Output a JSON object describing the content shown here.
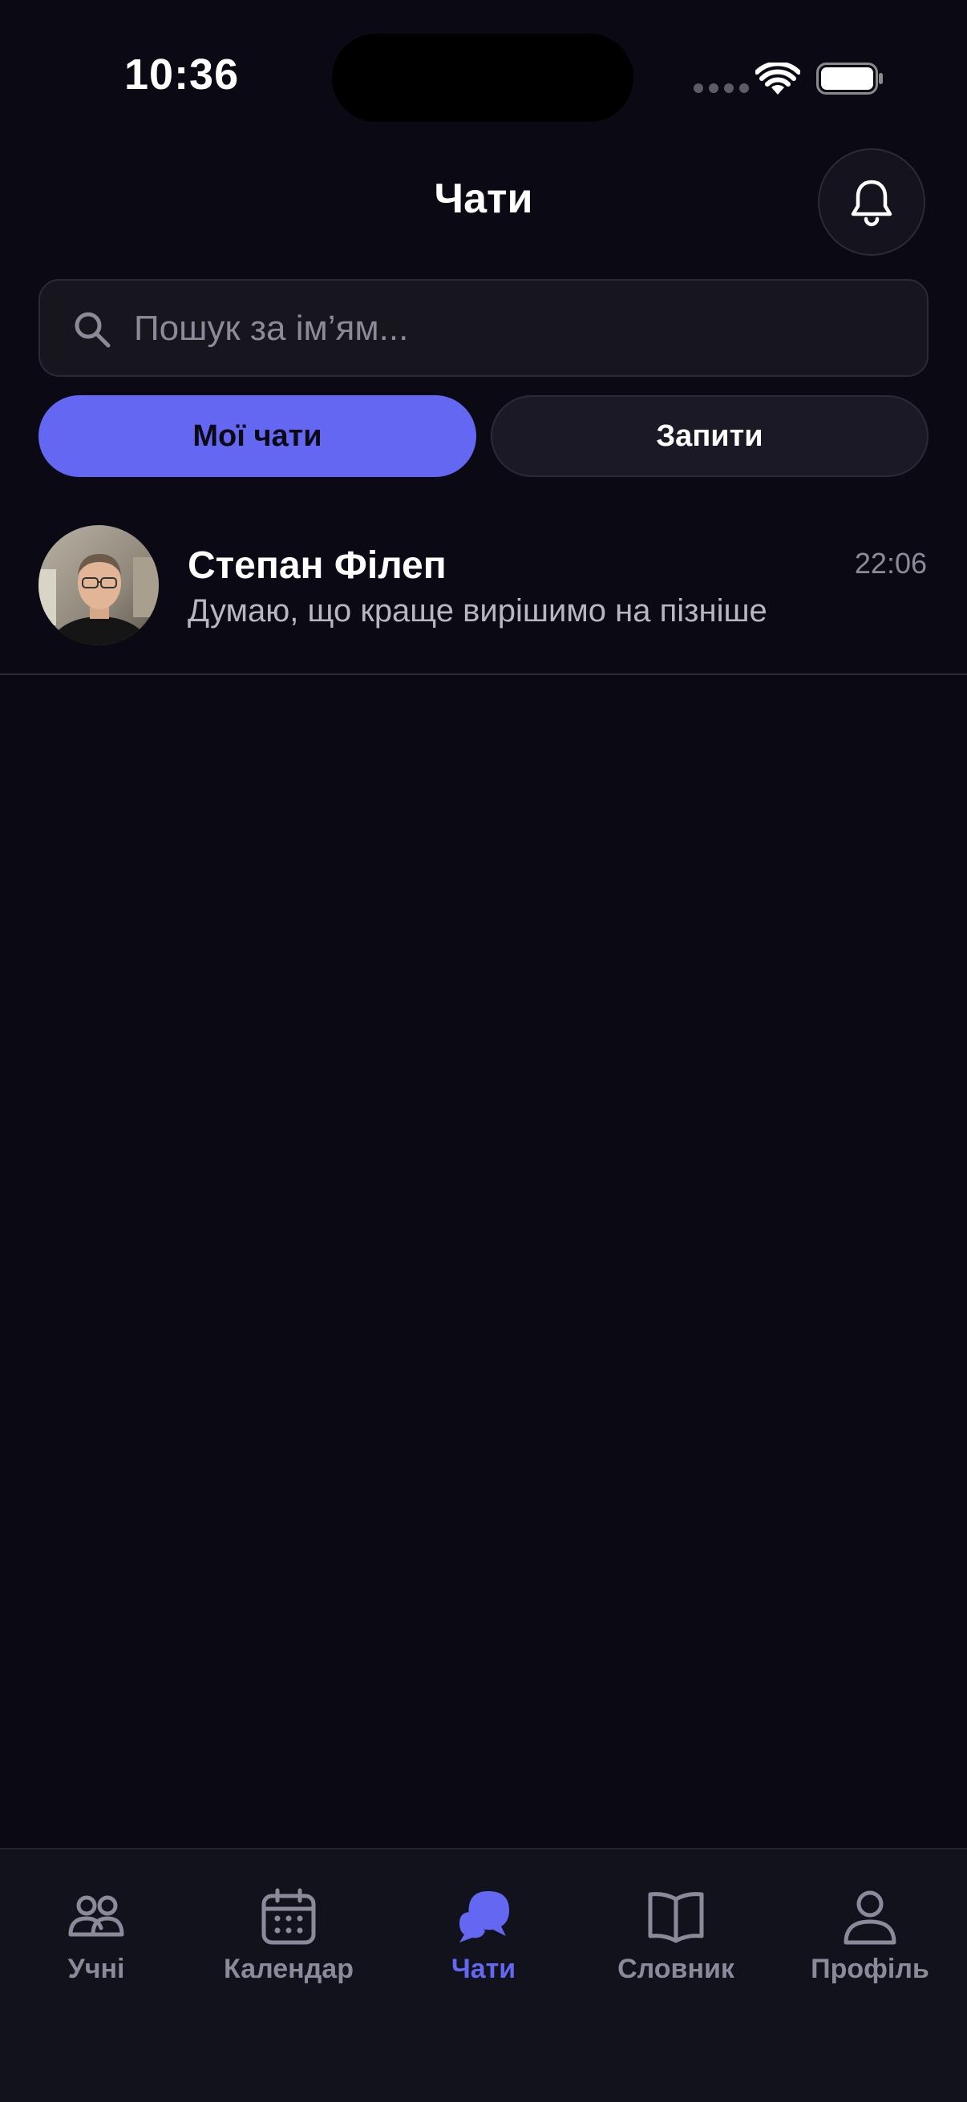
{
  "status_bar": {
    "time": "10:36"
  },
  "header": {
    "title": "Чати",
    "bell_icon": "bell-icon"
  },
  "search": {
    "placeholder": "Пошук за ім’ям...",
    "value": "",
    "icon": "search-icon"
  },
  "tabs": [
    {
      "label": "Мої чати",
      "selected": true
    },
    {
      "label": "Запити",
      "selected": false
    }
  ],
  "chats": [
    {
      "name": "Степан Філеп",
      "time": "22:06",
      "preview": "Думаю, що краще вирішимо на пізніше"
    }
  ],
  "bottom_nav": {
    "items": [
      {
        "label": "Учні",
        "icon": "users-icon",
        "active": false
      },
      {
        "label": "Календар",
        "icon": "calendar-icon",
        "active": false
      },
      {
        "label": "Чати",
        "icon": "chat-bubbles-icon",
        "active": true
      },
      {
        "label": "Словник",
        "icon": "book-icon",
        "active": false
      },
      {
        "label": "Профіль",
        "icon": "profile-icon",
        "active": false
      }
    ]
  },
  "colors": {
    "background": "#0b0a14",
    "accent": "#6467f2",
    "surface": "#17161f",
    "muted_text": "#8b8a96"
  }
}
